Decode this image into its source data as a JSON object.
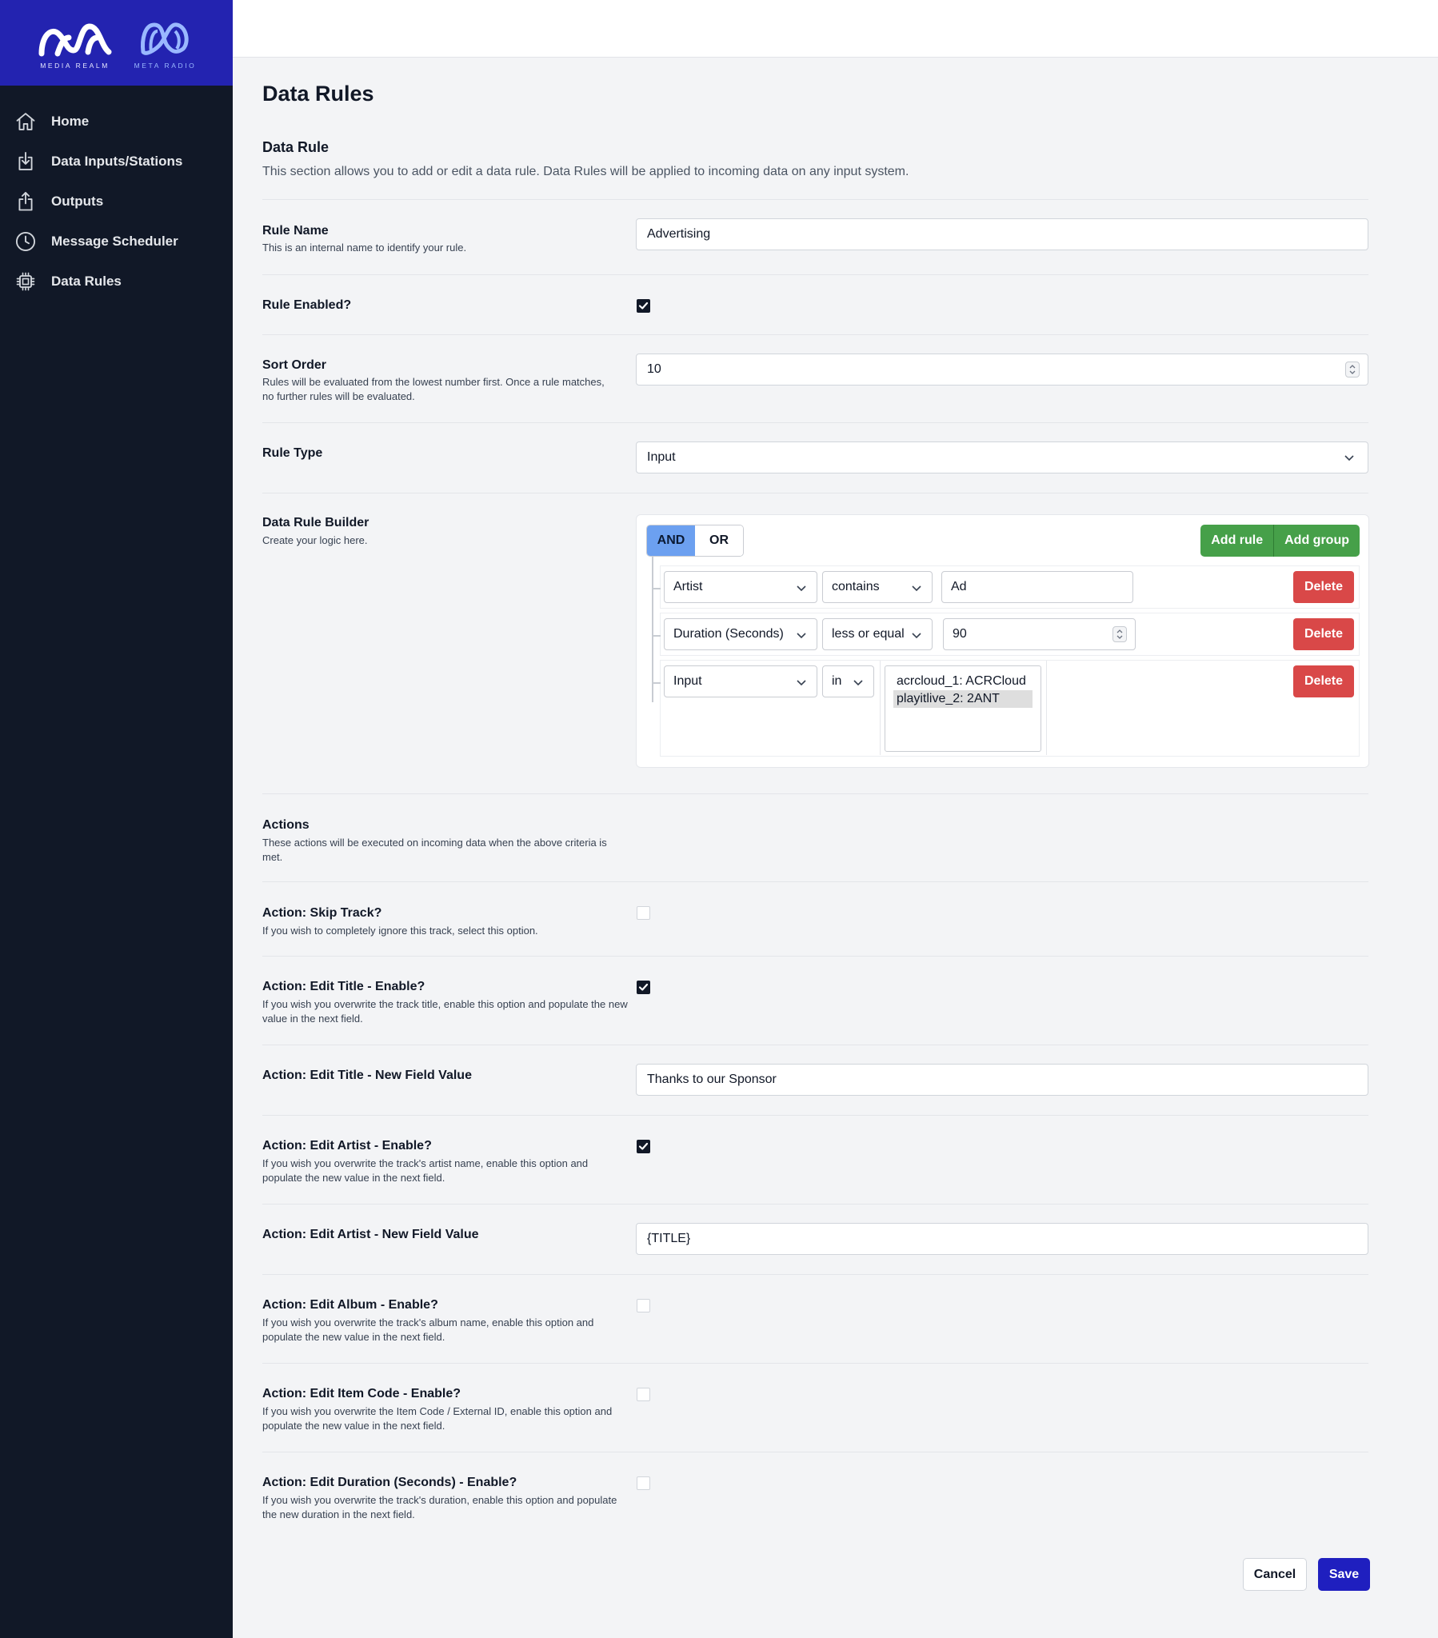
{
  "brand": {
    "logo1_caption": "MEDIA REALM",
    "logo2_caption": "META RADIO",
    "color": "#2323b0"
  },
  "sidebar": {
    "items": [
      {
        "label": "Home",
        "icon": "home-icon"
      },
      {
        "label": "Data Inputs/Stations",
        "icon": "inbox-download-icon"
      },
      {
        "label": "Outputs",
        "icon": "share-upload-icon"
      },
      {
        "label": "Message Scheduler",
        "icon": "clock-icon"
      },
      {
        "label": "Data Rules",
        "icon": "chip-icon"
      }
    ]
  },
  "page": {
    "title": "Data Rules",
    "section_title": "Data Rule",
    "section_desc": "This section allows you to add or edit a data rule. Data Rules will be applied to incoming data on any input system."
  },
  "form": {
    "rule_name": {
      "label": "Rule Name",
      "hint": "This is an internal name to identify your rule.",
      "value": "Advertising"
    },
    "rule_enabled": {
      "label": "Rule Enabled?",
      "checked": true
    },
    "sort_order": {
      "label": "Sort Order",
      "hint": "Rules will be evaluated from the lowest number first. Once a rule matches, no further rules will be evaluated.",
      "value": "10"
    },
    "rule_type": {
      "label": "Rule Type",
      "value": "Input"
    },
    "builder": {
      "label": "Data Rule Builder",
      "hint": "Create your logic here.",
      "and_label": "AND",
      "or_label": "OR",
      "add_rule_label": "Add rule",
      "add_group_label": "Add group",
      "delete_label": "Delete",
      "rules": [
        {
          "field": "Artist",
          "operator": "contains",
          "value": "Ad"
        },
        {
          "field": "Duration (Seconds)",
          "operator": "less or equal",
          "value": "90"
        },
        {
          "field": "Input",
          "operator": "in",
          "options": [
            "acrcloud_1: ACRCloud",
            "playitlive_2: 2ANT"
          ],
          "selected": "playitlive_2: 2ANT"
        }
      ]
    },
    "actions": {
      "label": "Actions",
      "hint": "These actions will be executed on incoming data when the above criteria is met."
    },
    "skip_track": {
      "label": "Action: Skip Track?",
      "hint": "If you wish to completely ignore this track, select this option.",
      "checked": false
    },
    "edit_title_enable": {
      "label": "Action: Edit Title - Enable?",
      "hint": "If you wish you overwrite the track title, enable this option and populate the new value in the next field.",
      "checked": true
    },
    "edit_title_value": {
      "label": "Action: Edit Title - New Field Value",
      "value": "Thanks to our Sponsor"
    },
    "edit_artist_enable": {
      "label": "Action: Edit Artist - Enable?",
      "hint": "If you wish you overwrite the track's artist name, enable this option and populate the new value in the next field.",
      "checked": true
    },
    "edit_artist_value": {
      "label": "Action: Edit Artist - New Field Value",
      "value": "{TITLE}"
    },
    "edit_album_enable": {
      "label": "Action: Edit Album - Enable?",
      "hint": "If you wish you overwrite the track's album name, enable this option and populate the new value in the next field.",
      "checked": false
    },
    "edit_itemcode_enable": {
      "label": "Action: Edit Item Code - Enable?",
      "hint": "If you wish you overwrite the Item Code / External ID, enable this option and populate the new value in the next field.",
      "checked": false
    },
    "edit_duration_enable": {
      "label": "Action: Edit Duration (Seconds) - Enable?",
      "hint": "If you wish you overwrite the track's duration, enable this option and populate the new duration in the next field.",
      "checked": false
    }
  },
  "footer": {
    "cancel_label": "Cancel",
    "save_label": "Save",
    "save_color": "#1f1fbf"
  }
}
